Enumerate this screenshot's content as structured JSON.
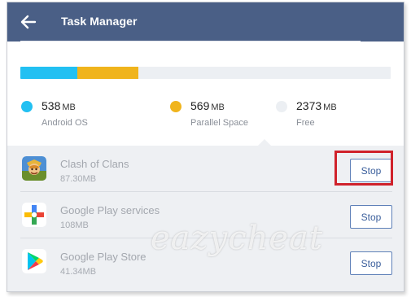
{
  "header": {
    "title": "Task Manager",
    "back_icon": "arrow-left-icon"
  },
  "storage": {
    "segments": [
      {
        "name": "Android OS",
        "value": 538,
        "color": "#22c0f2"
      },
      {
        "name": "Parallel Space",
        "value": 569,
        "color": "#f0b41c"
      },
      {
        "name": "Free",
        "value": 2373,
        "color": "#eceff3"
      }
    ],
    "unit": "MB",
    "legend": [
      {
        "value": "538",
        "unit": "MB",
        "label": "Android OS",
        "color": "#22c0f2"
      },
      {
        "value": "569",
        "unit": "MB",
        "label": "Parallel Space",
        "color": "#f0b41c"
      },
      {
        "value": "2373",
        "unit": "MB",
        "label": "Free",
        "color": "#eceff3"
      }
    ]
  },
  "apps": [
    {
      "name": "Clash of Clans",
      "size": "87.30MB",
      "stop_label": "Stop",
      "icon": "clash-of-clans-icon"
    },
    {
      "name": "Google Play services",
      "size": "108MB",
      "stop_label": "Stop",
      "icon": "google-play-services-icon"
    },
    {
      "name": "Google Play Store",
      "size": "41.34MB",
      "stop_label": "Stop",
      "icon": "google-play-store-icon"
    }
  ],
  "colors": {
    "header": "#4a5f86",
    "accent": "#5e80b8",
    "highlight": "#d0222b"
  },
  "watermark": "eazycheat"
}
